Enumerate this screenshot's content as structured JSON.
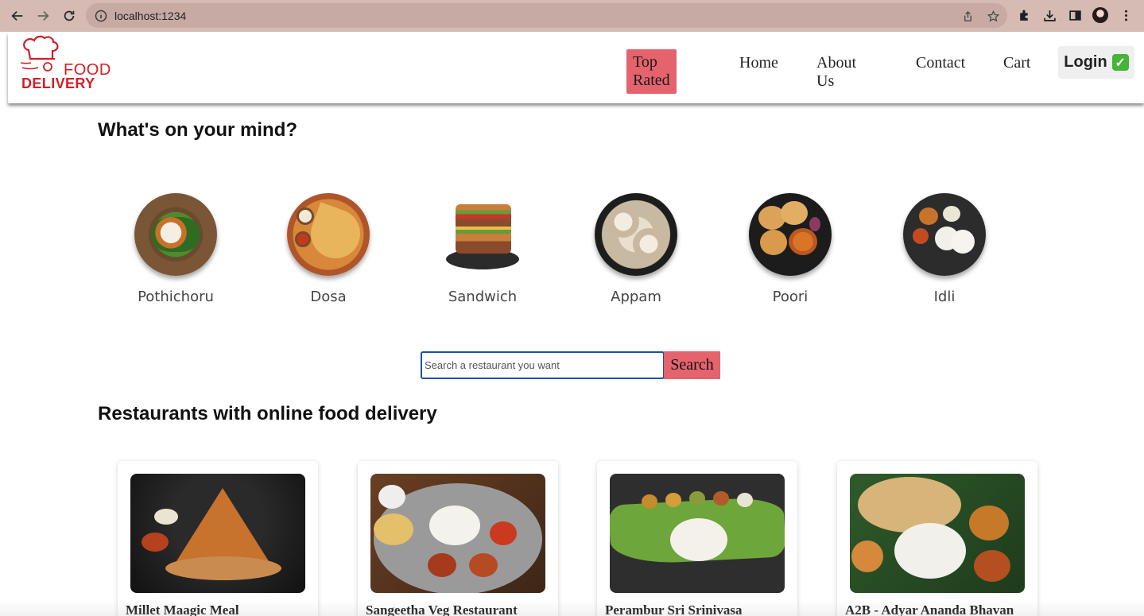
{
  "browser": {
    "url": "localhost:1234",
    "icons": [
      "back-icon",
      "forward-icon",
      "reload-icon",
      "info-icon",
      "share-icon",
      "star-icon",
      "extensions-icon",
      "download-icon",
      "sidebar-icon",
      "profile-avatar",
      "kebab-menu-icon"
    ]
  },
  "header": {
    "logo_top": "FOOD",
    "logo_bottom": "DELIVERY",
    "nav": {
      "top_rated": "Top Rated",
      "home": "Home",
      "about": "About Us",
      "contact": "Contact",
      "cart": "Cart",
      "login": "Login",
      "login_icon": "✓"
    },
    "accent": "#e4636d",
    "brand": "#d21f26"
  },
  "mind": {
    "title": "What's on your mind?",
    "dishes": [
      {
        "name": "Pothichoru"
      },
      {
        "name": "Dosa"
      },
      {
        "name": "Sandwich"
      },
      {
        "name": "Appam"
      },
      {
        "name": "Poori"
      },
      {
        "name": "Idli"
      }
    ]
  },
  "search": {
    "placeholder": "Search a restaurant you want",
    "button": "Search"
  },
  "restaurants": {
    "title": "Restaurants with online food delivery",
    "cards": [
      {
        "name": "Millet Maagic Meal"
      },
      {
        "name": "Sangeetha Veg Restaurant"
      },
      {
        "name": "Perambur Sri Srinivasa"
      },
      {
        "name": "A2B - Adyar Ananda Bhavan"
      }
    ]
  }
}
